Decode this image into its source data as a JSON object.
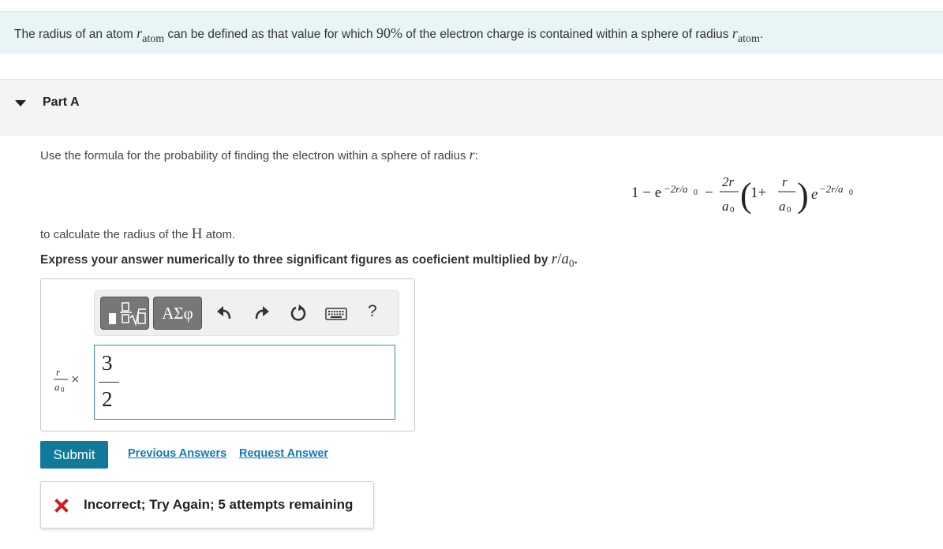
{
  "intro": {
    "text_before": "The radius of an atom ",
    "r_symbol": "r",
    "r_subscript": "atom",
    "text_middle": " can be defined as that value for which ",
    "percent": "90%",
    "text_after": " of the electron charge is contained within a sphere of radius ",
    "end": "."
  },
  "part": {
    "title": "Part A"
  },
  "prompt1": {
    "text": "Use the formula for the probability of finding the electron within a sphere of radius ",
    "var": "r",
    "end": ":"
  },
  "formula": {
    "one_minus_e": "1 − e",
    "exponent": "−2r/a",
    "minus": "−",
    "frac1_num": "2r",
    "frac1_den": "a",
    "paren_open": "(",
    "one_plus": "1+",
    "frac2_num": "r",
    "frac2_den": "a",
    "paren_close": ")",
    "e": "e",
    "sub0": "0"
  },
  "prompt2": {
    "text_before": "to calculate the radius of the ",
    "element": "H",
    "text_after": " atom."
  },
  "instruction": {
    "text": "Express your answer numerically to three significant figures as coeficient multiplied by ",
    "r": "r",
    "slash": "/",
    "a": "a",
    "sub0": "0",
    "end": "."
  },
  "toolbar": {
    "symbols_label": "ΑΣφ",
    "help_label": "?",
    "icons": [
      "templates-icon",
      "undo-icon",
      "redo-icon",
      "reset-icon",
      "keyboard-icon"
    ]
  },
  "unit": {
    "num": "r",
    "den": "a",
    "sub0": "0",
    "times": "×"
  },
  "answer": {
    "numerator": "3",
    "denominator": "2"
  },
  "actions": {
    "submit_label": "Submit",
    "previous_answers_label": "Previous Answers",
    "request_answer_label": "Request Answer"
  },
  "feedback": {
    "text": "Incorrect; Try Again; 5 attempts remaining",
    "status_color": "#cc1f1f"
  },
  "colors": {
    "accent": "#117a9a",
    "link": "#157ab2",
    "intro_bg": "#e8f4f6"
  }
}
